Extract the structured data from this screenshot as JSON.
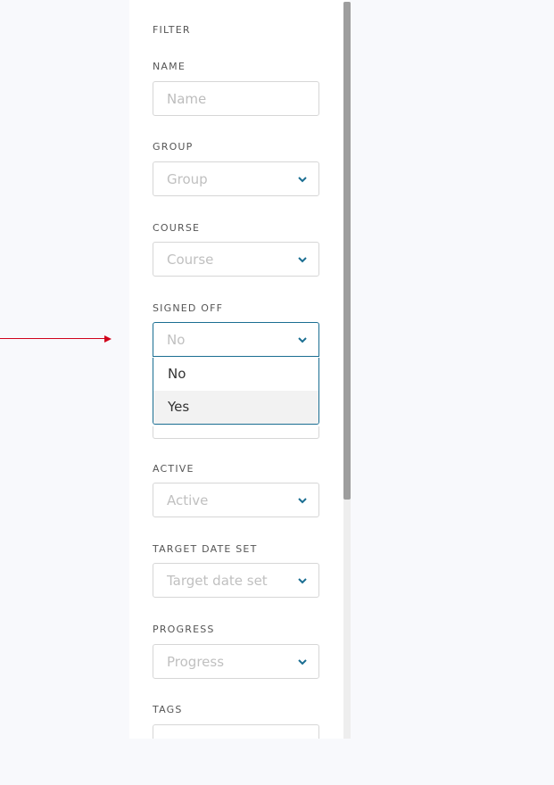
{
  "filter": {
    "heading": "FILTER",
    "fields": {
      "name": {
        "label": "NAME",
        "placeholder": "Name"
      },
      "group": {
        "label": "GROUP",
        "placeholder": "Group"
      },
      "course": {
        "label": "COURSE",
        "placeholder": "Course"
      },
      "signed_off": {
        "label": "SIGNED OFF",
        "placeholder": "No",
        "options": [
          "No",
          "Yes"
        ]
      },
      "active": {
        "label": "ACTIVE",
        "placeholder": "Active"
      },
      "target_date_set": {
        "label": "TARGET DATE SET",
        "placeholder": "Target date set"
      },
      "progress": {
        "label": "PROGRESS",
        "placeholder": "Progress"
      },
      "tags": {
        "label": "TAGS",
        "placeholder": ""
      }
    }
  },
  "colors": {
    "accent": "#1a6e92",
    "annotation_arrow": "#d0021b"
  },
  "icons": {
    "select_chevron": "chevron-down-icon"
  }
}
